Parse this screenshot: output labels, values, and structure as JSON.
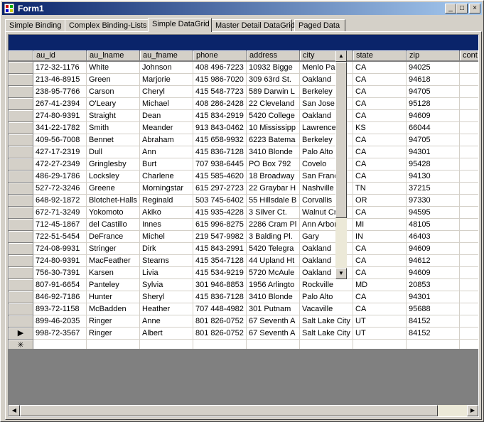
{
  "window": {
    "title": "Form1"
  },
  "titlebar_buttons": {
    "minimize": "_",
    "maximize": "□",
    "close": "×"
  },
  "tabs": [
    {
      "label": "Simple Binding"
    },
    {
      "label": "Complex Binding-Lists"
    },
    {
      "label": "Simple DataGrid"
    },
    {
      "label": "Master Detail DataGrid"
    },
    {
      "label": "Paged Data"
    }
  ],
  "active_tab": "Simple DataGrid",
  "grid": {
    "columns": [
      "au_id",
      "au_lname",
      "au_fname",
      "phone",
      "address",
      "city",
      "state",
      "zip",
      "cont"
    ],
    "rows": [
      [
        "172-32-1176",
        "White",
        "Johnson",
        "408 496-7223",
        "10932 Bigge",
        "Menlo Par",
        "CA",
        "94025"
      ],
      [
        "213-46-8915",
        "Green",
        "Marjorie",
        "415 986-7020",
        "309 63rd St.",
        "Oakland",
        "CA",
        "94618"
      ],
      [
        "238-95-7766",
        "Carson",
        "Cheryl",
        "415 548-7723",
        "589 Darwin L",
        "Berkeley",
        "CA",
        "94705"
      ],
      [
        "267-41-2394",
        "O'Leary",
        "Michael",
        "408 286-2428",
        "22 Cleveland",
        "San Jose",
        "CA",
        "95128"
      ],
      [
        "274-80-9391",
        "Straight",
        "Dean",
        "415 834-2919",
        "5420 College",
        "Oakland",
        "CA",
        "94609"
      ],
      [
        "341-22-1782",
        "Smith",
        "Meander",
        "913 843-0462",
        "10 Mississipp",
        "Lawrence",
        "KS",
        "66044"
      ],
      [
        "409-56-7008",
        "Bennet",
        "Abraham",
        "415 658-9932",
        "6223 Batema",
        "Berkeley",
        "CA",
        "94705"
      ],
      [
        "427-17-2319",
        "Dull",
        "Ann",
        "415 836-7128",
        "3410 Blonde",
        "Palo Alto",
        "CA",
        "94301"
      ],
      [
        "472-27-2349",
        "Gringlesby",
        "Burt",
        "707 938-6445",
        "PO Box 792",
        "Covelo",
        "CA",
        "95428"
      ],
      [
        "486-29-1786",
        "Locksley",
        "Charlene",
        "415 585-4620",
        "18 Broadway",
        "San Franc",
        "CA",
        "94130"
      ],
      [
        "527-72-3246",
        "Greene",
        "Morningstar",
        "615 297-2723",
        "22 Graybar H",
        "Nashville",
        "TN",
        "37215"
      ],
      [
        "648-92-1872",
        "Blotchet-Halls",
        "Reginald",
        "503 745-6402",
        "55 Hillsdale B",
        "Corvallis",
        "OR",
        "97330"
      ],
      [
        "672-71-3249",
        "Yokomoto",
        "Akiko",
        "415 935-4228",
        "3 Silver Ct.",
        "Walnut Cr",
        "CA",
        "94595"
      ],
      [
        "712-45-1867",
        "del Castillo",
        "Innes",
        "615 996-8275",
        "2286 Cram Pl",
        "Ann Arbor",
        "MI",
        "48105"
      ],
      [
        "722-51-5454",
        "DeFrance",
        "Michel",
        "219 547-9982",
        "3 Balding Pl.",
        "Gary",
        "IN",
        "46403"
      ],
      [
        "724-08-9931",
        "Stringer",
        "Dirk",
        "415 843-2991",
        "5420 Telegra",
        "Oakland",
        "CA",
        "94609"
      ],
      [
        "724-80-9391",
        "MacFeather",
        "Stearns",
        "415 354-7128",
        "44 Upland Ht",
        "Oakland",
        "CA",
        "94612"
      ],
      [
        "756-30-7391",
        "Karsen",
        "Livia",
        "415 534-9219",
        "5720 McAule",
        "Oakland",
        "CA",
        "94609"
      ],
      [
        "807-91-6654",
        "Panteley",
        "Sylvia",
        "301 946-8853",
        "1956 Arlingto",
        "Rockville",
        "MD",
        "20853"
      ],
      [
        "846-92-7186",
        "Hunter",
        "Sheryl",
        "415 836-7128",
        "3410 Blonde",
        "Palo Alto",
        "CA",
        "94301"
      ],
      [
        "893-72-1158",
        "McBadden",
        "Heather",
        "707 448-4982",
        "301 Putnam",
        "Vacaville",
        "CA",
        "95688"
      ],
      [
        "899-46-2035",
        "Ringer",
        "Anne",
        "801 826-0752",
        "67 Seventh A",
        "Salt Lake City",
        "UT",
        "84152"
      ],
      [
        "998-72-3567",
        "Ringer",
        "Albert",
        "801 826-0752",
        "67 Seventh A",
        "Salt Lake City",
        "UT",
        "84152"
      ]
    ],
    "current_row_marker": "▶",
    "new_row_marker": "✳"
  },
  "scroll": {
    "up": "▲",
    "down": "▼",
    "left": "◀",
    "right": "▶"
  }
}
